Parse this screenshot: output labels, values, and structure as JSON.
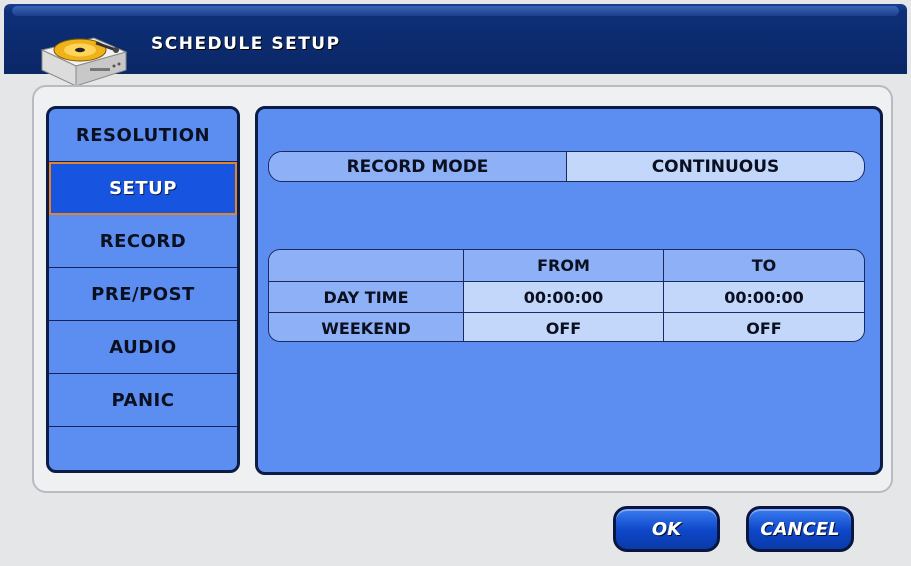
{
  "window": {
    "title": "SCHEDULE SETUP"
  },
  "sidebar": {
    "items": [
      {
        "label": "RESOLUTION"
      },
      {
        "label": "SETUP",
        "active": true
      },
      {
        "label": "RECORD"
      },
      {
        "label": "PRE/POST"
      },
      {
        "label": "AUDIO"
      },
      {
        "label": "PANIC"
      },
      {
        "label": ""
      }
    ]
  },
  "record_mode": {
    "label": "RECORD MODE",
    "value": "CONTINUOUS"
  },
  "schedule": {
    "headers": [
      "",
      "FROM",
      "TO"
    ],
    "rows": [
      {
        "label": "DAY TIME",
        "from": "00:00:00",
        "to": "00:00:00"
      },
      {
        "label": "WEEKEND",
        "from": "OFF",
        "to": "OFF"
      }
    ]
  },
  "buttons": {
    "ok": "OK",
    "cancel": "CANCEL"
  },
  "colors": {
    "panel_blue": "#5b8ef0",
    "active_item": "#1754e0",
    "active_border": "#e08430",
    "cell_light": "#c3d7fb",
    "cell_mid": "#8eb0f7",
    "titlebar": "#0a2766"
  },
  "icons": {
    "app": "disc-recorder-icon"
  }
}
